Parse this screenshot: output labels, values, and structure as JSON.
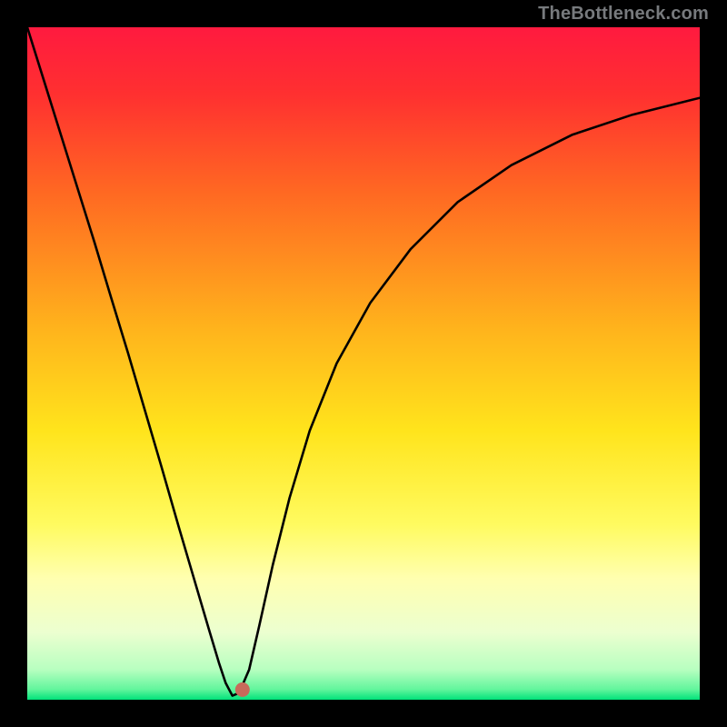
{
  "watermark": "TheBottleneck.com",
  "gradient": {
    "stops": [
      {
        "offset": 0.0,
        "color": "#ff1a3f"
      },
      {
        "offset": 0.1,
        "color": "#ff3030"
      },
      {
        "offset": 0.25,
        "color": "#ff6a22"
      },
      {
        "offset": 0.45,
        "color": "#ffb41c"
      },
      {
        "offset": 0.6,
        "color": "#ffe41c"
      },
      {
        "offset": 0.74,
        "color": "#fffb60"
      },
      {
        "offset": 0.82,
        "color": "#ffffb0"
      },
      {
        "offset": 0.9,
        "color": "#ecffd0"
      },
      {
        "offset": 0.955,
        "color": "#b8ffc0"
      },
      {
        "offset": 0.985,
        "color": "#60f59c"
      },
      {
        "offset": 1.0,
        "color": "#00e27a"
      }
    ]
  },
  "marker": {
    "x_pct": 0.32,
    "y_pct": 0.985,
    "color": "#c86a5a",
    "radius": 8
  },
  "chart_data": {
    "type": "line",
    "title": "",
    "xlabel": "",
    "ylabel": "",
    "xlim": [
      0,
      1
    ],
    "ylim": [
      0,
      1
    ],
    "note": "V-shaped bottleneck curve; minimum at x≈0.305. y is mismatch (0 best, 1 worst). Background gradient maps y: green≈0 → red≈1.",
    "series": [
      {
        "name": "bottleneck-curve",
        "x": [
          0.0,
          0.025,
          0.05,
          0.075,
          0.1,
          0.125,
          0.15,
          0.175,
          0.2,
          0.225,
          0.25,
          0.27,
          0.285,
          0.295,
          0.305,
          0.315,
          0.33,
          0.345,
          0.365,
          0.39,
          0.42,
          0.46,
          0.51,
          0.57,
          0.64,
          0.72,
          0.81,
          0.9,
          1.0
        ],
        "y": [
          1.0,
          0.92,
          0.84,
          0.76,
          0.68,
          0.597,
          0.515,
          0.43,
          0.345,
          0.258,
          0.173,
          0.105,
          0.055,
          0.025,
          0.006,
          0.01,
          0.045,
          0.11,
          0.2,
          0.3,
          0.4,
          0.5,
          0.59,
          0.67,
          0.74,
          0.795,
          0.84,
          0.87,
          0.895
        ]
      }
    ],
    "marker_point": {
      "x": 0.32,
      "y": 0.015
    }
  }
}
